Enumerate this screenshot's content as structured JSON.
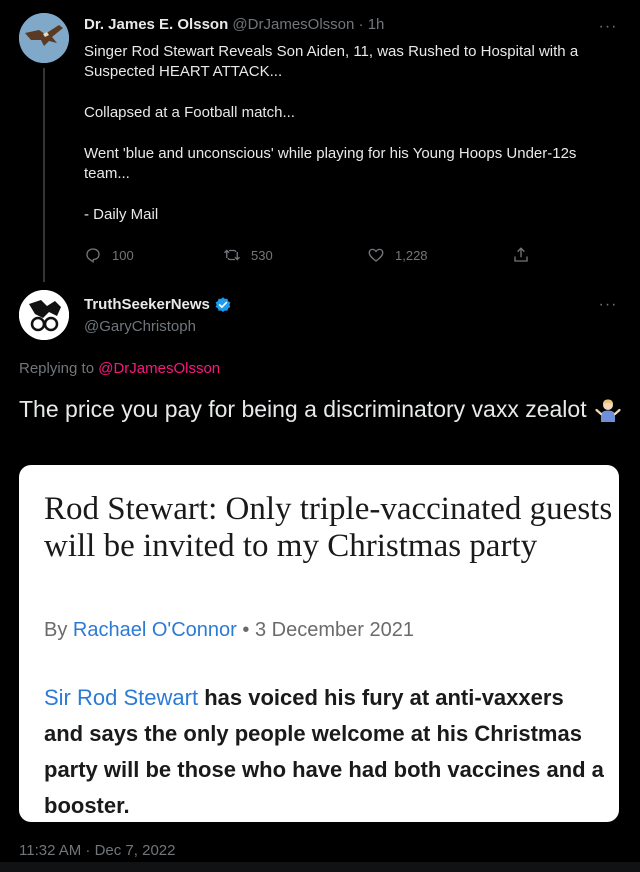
{
  "parent_tweet": {
    "author_name": "Dr. James E. Olsson",
    "handle": "@DrJamesOlsson",
    "separator": "·",
    "time": "1h",
    "more_icon": "more-horizontal-icon",
    "lines": [
      "Singer Rod Stewart Reveals Son Aiden, 11, was Rushed to Hospital with a Suspected HEART ATTACK...",
      "Collapsed at a Football match...",
      "Went 'blue and unconscious' while playing for his Young Hoops Under-12s team...",
      "- Daily Mail"
    ],
    "actions": {
      "replies": "100",
      "retweets": "530",
      "likes": "1,228"
    }
  },
  "reply_tweet": {
    "author_name": "TruthSeekerNews",
    "verified": true,
    "handle": "@GaryChristoph",
    "replying_prefix": "Replying to",
    "replying_to": "@DrJamesOlsson",
    "text": "The price you pay for being a discriminatory vaxx zealot",
    "emoji": "person-shrugging-emoji",
    "timestamp": "11:32 AM · Dec 7, 2022"
  },
  "article_card": {
    "headline": "Rod Stewart: Only triple-vaccinated guests will be invited to my Christmas party",
    "byline_prefix": "By",
    "author": "Rachael O'Connor",
    "byline_separator": "•",
    "date": "3 December 2021",
    "lede_link": "Sir Rod Stewart",
    "lede_rest": "has voiced his fury at anti-vaxxers and says the only people welcome at his Christmas party will be those who have had both vaccines and a booster."
  },
  "colors": {
    "background": "#000000",
    "text": "#e7e9ea",
    "muted": "#71767b",
    "mention": "#f91880",
    "verified": "#1d9bf0",
    "card_link": "#2b7bd6"
  }
}
